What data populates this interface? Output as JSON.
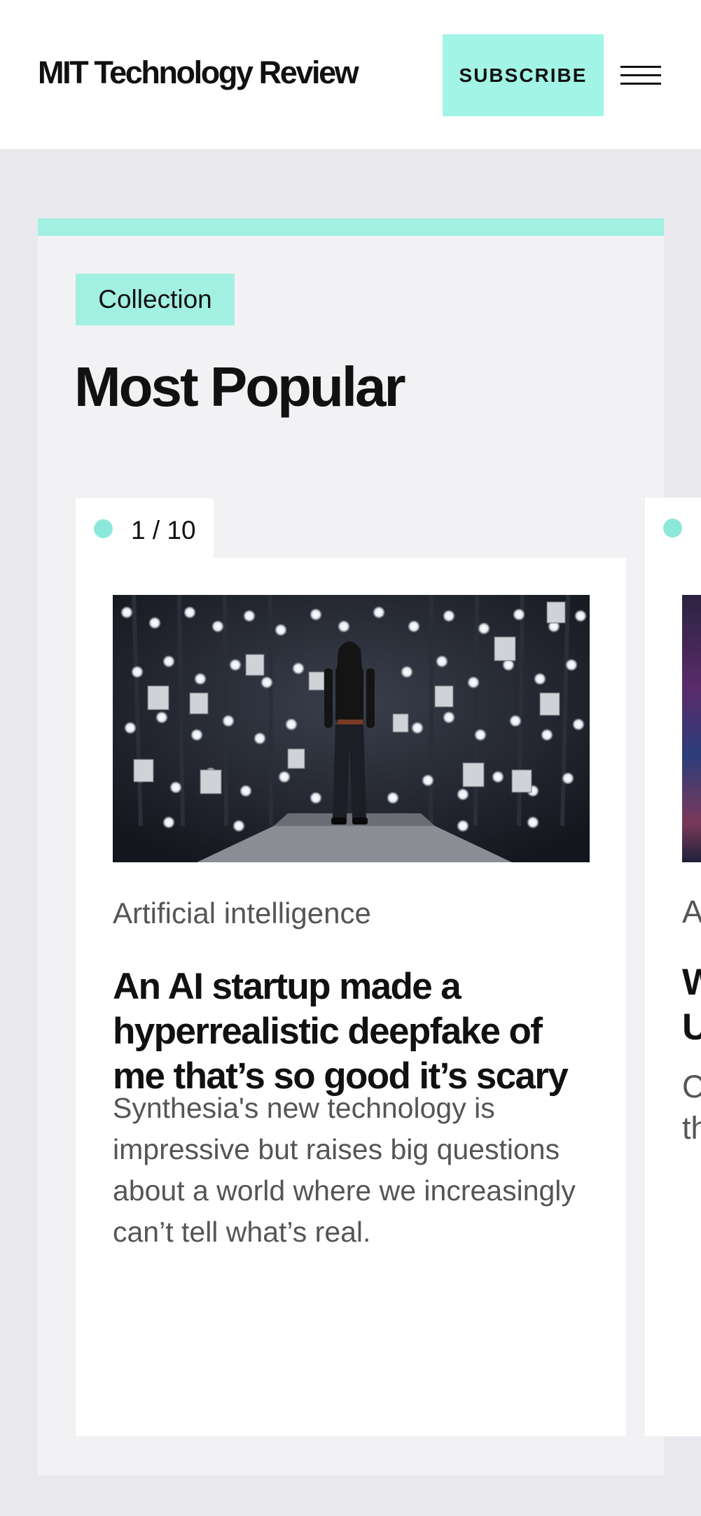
{
  "header": {
    "logo_text": "MIT Technology Review",
    "subscribe_label": "SUBSCRIBE",
    "menu_icon": "hamburger-menu-icon"
  },
  "collection": {
    "tag": "Collection",
    "title": "Most Popular",
    "accent_color": "#a2f0e2"
  },
  "cards": [
    {
      "counter": "1 / 10",
      "category": "Artificial intelligence",
      "headline": "An AI startup made a hyperrealistic deepfake of me that’s so good it’s scary",
      "summary": "Synthesia's new technology is impressive but raises big questions about a world where we increasingly can’t tell what’s real."
    },
    {
      "partial_category": "A",
      "partial_headline_line1": "W",
      "partial_headline_line2": "U",
      "partial_summary_line1": "C",
      "partial_summary_line2": "th"
    }
  ]
}
